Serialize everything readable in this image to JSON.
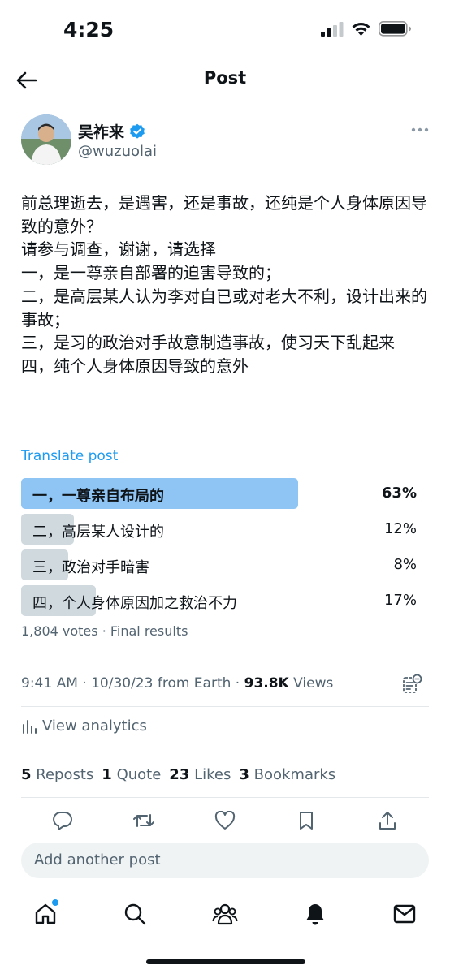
{
  "status_bar": {
    "time": "4:25"
  },
  "header": {
    "title": "Post"
  },
  "author": {
    "name": "吴祚来",
    "handle": "@wuzuolai"
  },
  "post": {
    "text": "前总理逝去，是遇害，还是事故，还纯是个人身体原因导致的意外？\n请参与调查，谢谢，请选择\n一，是一尊亲自部署的迫害导致的；\n二，是高层某人认为李对自已或对老大不利，设计出来的事故；\n三，是习的政治对手故意制造事故，使习天下乱起来\n四，纯个人身体原因导致的意外",
    "translate_label": "Translate post"
  },
  "poll": {
    "options": [
      {
        "label": "一，一尊亲自布局的",
        "percent": "63%",
        "value": 63
      },
      {
        "label": "二，高层某人设计的",
        "percent": "12%",
        "value": 12
      },
      {
        "label": "三，政治对手暗害",
        "percent": "8%",
        "value": 8
      },
      {
        "label": "四，个人身体原因加之救治不力",
        "percent": "17%",
        "value": 17
      }
    ],
    "meta": "1,804 votes · Final results"
  },
  "meta": {
    "time": "9:41 AM · 10/30/23 from Earth · ",
    "views_count": "93.8K",
    "views_label": " Views"
  },
  "analytics_label": "View analytics",
  "stats": {
    "reposts_count": "5",
    "reposts_label": "Reposts",
    "quotes_count": "1",
    "quotes_label": "Quote",
    "likes_count": "23",
    "likes_label": "Likes",
    "bookmarks_count": "3",
    "bookmarks_label": "Bookmarks"
  },
  "reply": {
    "placeholder": "Add another post"
  },
  "colors": {
    "accent": "#1d9bf0",
    "winner_bar": "#8ec5f5",
    "loser_bar": "#cfd9de",
    "secondary_text": "#536471"
  }
}
